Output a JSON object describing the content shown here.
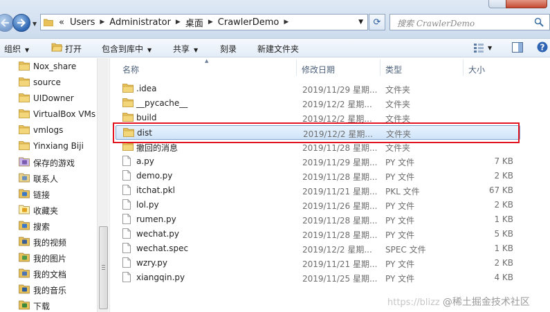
{
  "address": {
    "crumb_prefix": "«",
    "crumbs": [
      "Users",
      "Administrator",
      "桌面",
      "CrawlerDemo"
    ],
    "search_placeholder": "搜索 CrawlerDemo"
  },
  "toolbar": {
    "organize": "组织",
    "open": "打开",
    "include_library": "包含到库中",
    "share": "共享",
    "burn": "刻录",
    "new_folder": "新建文件夹"
  },
  "sidebar": {
    "items": [
      {
        "label": "Nox_share",
        "icon": "folder-icon"
      },
      {
        "label": "source",
        "icon": "folder-icon"
      },
      {
        "label": "UIDowner",
        "icon": "folder-icon"
      },
      {
        "label": "VirtualBox VMs",
        "icon": "folder-icon"
      },
      {
        "label": "vmlogs",
        "icon": "folder-icon"
      },
      {
        "label": "Yinxiang Biji",
        "icon": "folder-icon"
      },
      {
        "label": "保存的游戏",
        "icon": "saved-games-icon"
      },
      {
        "label": "联系人",
        "icon": "contacts-icon"
      },
      {
        "label": "链接",
        "icon": "links-icon"
      },
      {
        "label": "收藏夹",
        "icon": "favorites-icon"
      },
      {
        "label": "搜索",
        "icon": "searches-icon"
      },
      {
        "label": "我的视频",
        "icon": "videos-icon"
      },
      {
        "label": "我的图片",
        "icon": "pictures-icon"
      },
      {
        "label": "我的文档",
        "icon": "documents-icon"
      },
      {
        "label": "我的音乐",
        "icon": "music-icon"
      },
      {
        "label": "下载",
        "icon": "downloads-icon"
      }
    ]
  },
  "columns": {
    "name": "名称",
    "date": "修改日期",
    "type": "类型",
    "size": "大小"
  },
  "files": [
    {
      "name": ".idea",
      "date": "2019/11/29 星期...",
      "type": "文件夹",
      "size": "",
      "kind": "folder"
    },
    {
      "name": "__pycache__",
      "date": "2019/12/2 星期...",
      "type": "文件夹",
      "size": "",
      "kind": "folder"
    },
    {
      "name": "build",
      "date": "2019/12/2 星期...",
      "type": "文件夹",
      "size": "",
      "kind": "folder"
    },
    {
      "name": "dist",
      "date": "2019/12/2 星期...",
      "type": "文件夹",
      "size": "",
      "kind": "folder",
      "selected": true
    },
    {
      "name": "撤回的消息",
      "date": "2019/11/28 星期...",
      "type": "文件夹",
      "size": "",
      "kind": "folder"
    },
    {
      "name": "a.py",
      "date": "2019/11/29 星期...",
      "type": "PY 文件",
      "size": "7 KB",
      "kind": "file"
    },
    {
      "name": "demo.py",
      "date": "2019/11/28 星期...",
      "type": "PY 文件",
      "size": "2 KB",
      "kind": "file"
    },
    {
      "name": "itchat.pkl",
      "date": "2019/11/21 星期...",
      "type": "PKL 文件",
      "size": "67 KB",
      "kind": "file"
    },
    {
      "name": "lol.py",
      "date": "2019/11/26 星期...",
      "type": "PY 文件",
      "size": "2 KB",
      "kind": "file"
    },
    {
      "name": "rumen.py",
      "date": "2019/11/28 星期...",
      "type": "PY 文件",
      "size": "1 KB",
      "kind": "file"
    },
    {
      "name": "wechat.py",
      "date": "2019/11/28 星期...",
      "type": "PY 文件",
      "size": "5 KB",
      "kind": "file"
    },
    {
      "name": "wechat.spec",
      "date": "2019/12/2 星期...",
      "type": "SPEC 文件",
      "size": "1 KB",
      "kind": "file"
    },
    {
      "name": "wzry.py",
      "date": "2019/11/21 星期...",
      "type": "PY 文件",
      "size": "2 KB",
      "kind": "file"
    },
    {
      "name": "xiangqin.py",
      "date": "2019/11/25 星期...",
      "type": "PY 文件",
      "size": "4 KB",
      "kind": "file"
    }
  ],
  "watermark": {
    "url": "https://blizz",
    "brand": "@稀土掘金技术社区"
  },
  "colors": {
    "selection_border": "#7da2ce",
    "highlight_box": "#e2141f",
    "folder": "#e8c15a"
  }
}
